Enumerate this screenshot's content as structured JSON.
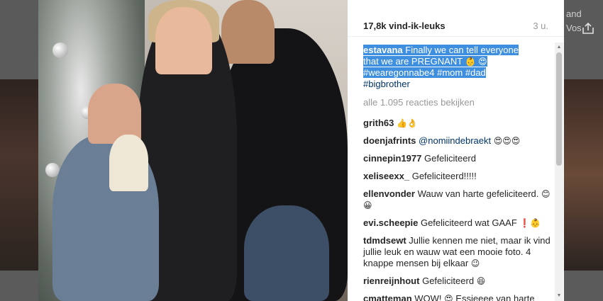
{
  "background": {
    "text_lines": [
      "and",
      "Vos"
    ]
  },
  "post": {
    "likes": "17,8k vind-ik-leuks",
    "time": "3 u.",
    "caption": {
      "user": "estavana",
      "text_line1": "Finally we can tell everyone",
      "text_line2": "that we are PREGNANT",
      "emoji_1": "👶",
      "emoji_2": "😍",
      "hashtags_line": [
        "#wearegonnabe4",
        "#mom",
        "#dad"
      ],
      "hashtag_extra": "#bigbrother"
    },
    "view_all": "alle 1.095 reacties bekijken",
    "comments": [
      {
        "user": "grith63",
        "text": "",
        "emoji": "👍👌"
      },
      {
        "user": "doenjafrints",
        "mention": "@nomiindebraekt",
        "text": "",
        "emoji": "😍😍😍"
      },
      {
        "user": "cinnepin1977",
        "text": "Gefeliciteerd",
        "emoji": ""
      },
      {
        "user": "xeliseexx_",
        "text": "Gefeliciteerd!!!!!",
        "emoji": ""
      },
      {
        "user": "ellenvonder",
        "text": "Wauw van harte gefeliciteerd.",
        "emoji": "😊😀"
      },
      {
        "user": "evi.scheepie",
        "text": "Gefeliciteerd wat GAAF",
        "emoji": "❗👶"
      },
      {
        "user": "tdmdsewt",
        "text": "Jullie kennen me niet, maar ik vind jullie leuk en wauw wat een mooie foto. 4 knappe mensen bij elkaar",
        "emoji": "😉"
      },
      {
        "user": "rienreijnhout",
        "text": "Gefeliciteerd",
        "emoji": "😆"
      },
      {
        "user": "cmatteman",
        "text": "WOW!",
        "emoji": "😍",
        "text2": "Essieeee van harte"
      }
    ]
  },
  "colors": {
    "highlight": "#3f8fe0",
    "link": "#003569",
    "muted": "#999999"
  }
}
